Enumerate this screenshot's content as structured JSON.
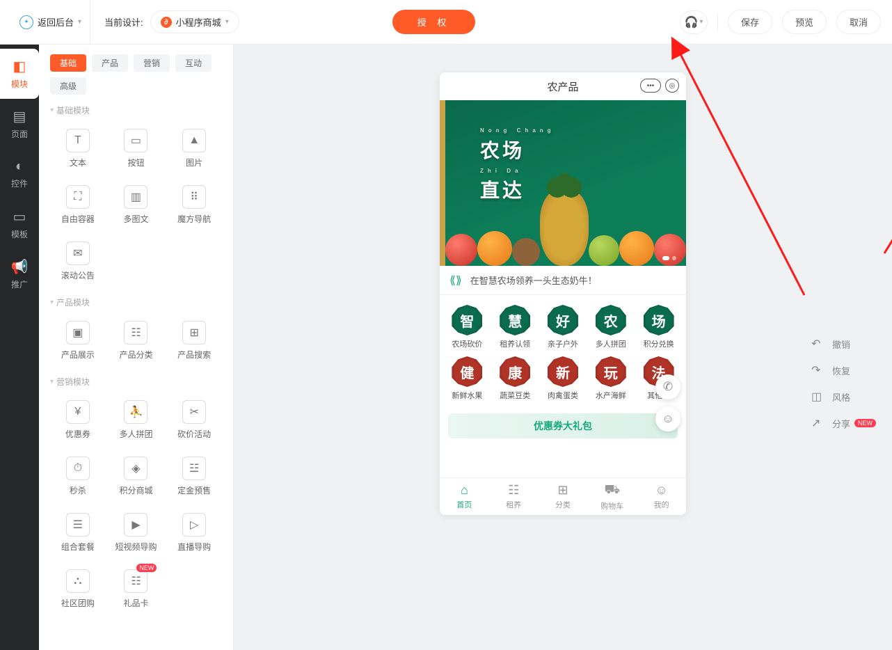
{
  "header": {
    "back": "返回后台",
    "cur_design_label": "当前设计:",
    "design_name": "小程序商城",
    "auth": "授 权",
    "save": "保存",
    "preview": "预览",
    "cancel": "取消"
  },
  "rail": [
    {
      "icon": "◧",
      "label": "模块"
    },
    {
      "icon": "▤",
      "label": "页面"
    },
    {
      "icon": "◐",
      "label": "控件"
    },
    {
      "icon": "▭",
      "label": "模板"
    },
    {
      "icon": "📢",
      "label": "推广"
    }
  ],
  "tabs": [
    "基础",
    "产品",
    "营销",
    "互动",
    "高级"
  ],
  "sections": {
    "basic": {
      "title": "基础模块",
      "items": [
        {
          "icon": "T",
          "label": "文本"
        },
        {
          "icon": "▭",
          "label": "按钮"
        },
        {
          "icon": "▲",
          "label": "图片"
        },
        {
          "icon": "⛶",
          "label": "自由容器"
        },
        {
          "icon": "▥",
          "label": "多图文"
        },
        {
          "icon": "⠿",
          "label": "魔方导航"
        },
        {
          "icon": "✉",
          "label": "滚动公告"
        }
      ]
    },
    "product": {
      "title": "产品模块",
      "items": [
        {
          "icon": "▣",
          "label": "产品展示"
        },
        {
          "icon": "☷",
          "label": "产品分类"
        },
        {
          "icon": "⊞",
          "label": "产品搜索"
        }
      ]
    },
    "marketing": {
      "title": "营销模块",
      "items": [
        {
          "icon": "¥",
          "label": "优惠券"
        },
        {
          "icon": "⛹",
          "label": "多人拼团"
        },
        {
          "icon": "✂",
          "label": "砍价活动"
        },
        {
          "icon": "⏱",
          "label": "秒杀"
        },
        {
          "icon": "◈",
          "label": "积分商城"
        },
        {
          "icon": "☳",
          "label": "定金预售"
        },
        {
          "icon": "☰",
          "label": "组合套餐"
        },
        {
          "icon": "▶",
          "label": "短视频导购"
        },
        {
          "icon": "▷",
          "label": "直播导购"
        },
        {
          "icon": "⛬",
          "label": "社区团购"
        },
        {
          "icon": "☷",
          "label": "礼品卡",
          "new": "NEW"
        }
      ]
    }
  },
  "phone": {
    "title": "农产品",
    "banner": {
      "line1": "农场",
      "sub1": "Nong   Chang",
      "line2": "直达",
      "sub2": "Zhi        Da"
    },
    "announce": "在智慧农场领养一头生态奶牛！",
    "nav": [
      {
        "char": "智",
        "label": "农场砍价",
        "cls": "g"
      },
      {
        "char": "慧",
        "label": "租养认领",
        "cls": "g"
      },
      {
        "char": "好",
        "label": "亲子户外",
        "cls": "g"
      },
      {
        "char": "农",
        "label": "多人拼团",
        "cls": "g"
      },
      {
        "char": "场",
        "label": "积分兑换",
        "cls": "g"
      },
      {
        "char": "健",
        "label": "新鲜水果",
        "cls": "r"
      },
      {
        "char": "康",
        "label": "蔬菜豆类",
        "cls": "r"
      },
      {
        "char": "新",
        "label": "肉禽蛋类",
        "cls": "r"
      },
      {
        "char": "玩",
        "label": "水产海鲜",
        "cls": "r"
      },
      {
        "char": "法",
        "label": "其他农",
        "cls": "r"
      }
    ],
    "coupon": "优惠券大礼包",
    "tabs": [
      {
        "icon": "⌂",
        "label": "首页"
      },
      {
        "icon": "☷",
        "label": "租养"
      },
      {
        "icon": "⊞",
        "label": "分类"
      },
      {
        "icon": "⛟",
        "label": "购物车"
      },
      {
        "icon": "☺",
        "label": "我的"
      }
    ]
  },
  "side": [
    {
      "icon": "↶",
      "label": "撤销"
    },
    {
      "icon": "↷",
      "label": "恢复"
    },
    {
      "icon": "◫",
      "label": "风格"
    },
    {
      "icon": "↗",
      "label": "分享",
      "new": "NEW"
    }
  ]
}
